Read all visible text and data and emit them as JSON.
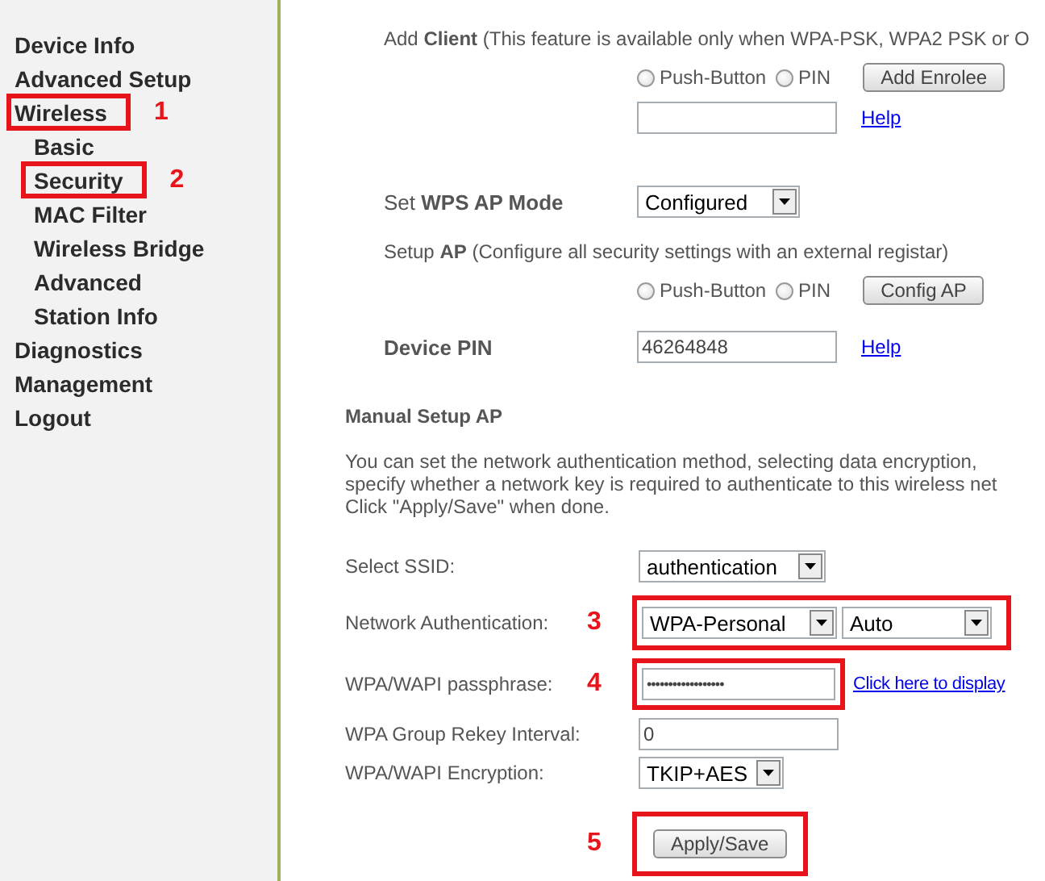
{
  "sidebar": {
    "items": [
      {
        "label": "Device Info"
      },
      {
        "label": "Advanced Setup"
      },
      {
        "label": "Wireless",
        "callout": "1",
        "children": [
          {
            "label": "Basic"
          },
          {
            "label": "Security",
            "callout": "2"
          },
          {
            "label": "MAC Filter"
          },
          {
            "label": "Wireless Bridge"
          },
          {
            "label": "Advanced"
          },
          {
            "label": "Station Info"
          }
        ]
      },
      {
        "label": "Diagnostics"
      },
      {
        "label": "Management"
      },
      {
        "label": "Logout"
      }
    ]
  },
  "add_client": {
    "text": "Add **Client** (This feature is available only when WPA-PSK, WPA2 PSK or O",
    "radios": [
      {
        "label": "Push-Button",
        "selected": false
      },
      {
        "label": "PIN",
        "selected": false
      }
    ],
    "button": "Add Enrolee",
    "help": "Help"
  },
  "wps_ap_mode": {
    "label": "Set **WPS AP Mode**",
    "value": "Configured"
  },
  "setup_ap": {
    "text": "Setup **AP** (Configure all security settings with an external registar)",
    "radios": [
      {
        "label": "Push-Button",
        "selected": false
      },
      {
        "label": "PIN",
        "selected": false
      }
    ],
    "button": "Config AP"
  },
  "device_pin": {
    "label": "Device PIN",
    "value": "46264848",
    "help": "Help"
  },
  "manual_setup": {
    "title": "Manual Setup AP",
    "description": [
      "You can set the network authentication method, selecting data encryption,",
      "specify whether a network key is required to authenticate to this wireless net",
      "Click \"Apply/Save\" when done."
    ],
    "fields": [
      {
        "kind": "select",
        "label": "Select SSID:",
        "values": [
          "authentication"
        ]
      },
      {
        "kind": "select",
        "label": "Network Authentication:",
        "values": [
          "WPA-Personal",
          "Auto"
        ],
        "callout": "3"
      },
      {
        "kind": "password",
        "label": "WPA/WAPI passphrase:",
        "value": "••••••••••••••••••",
        "link": "Click here to display",
        "callout": "4"
      },
      {
        "kind": "text",
        "label": "WPA Group Rekey Interval:",
        "value": "0"
      },
      {
        "kind": "select",
        "label": "WPA/WAPI Encryption:",
        "values": [
          "TKIP+AES"
        ]
      }
    ],
    "apply": {
      "label": "Apply/Save",
      "callout": "5"
    }
  }
}
